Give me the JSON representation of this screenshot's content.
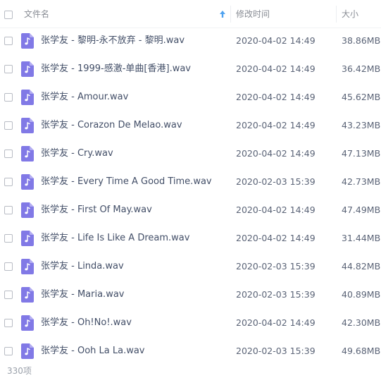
{
  "header": {
    "name_label": "文件名",
    "date_label": "修改时间",
    "size_label": "大小",
    "sort_icon": "sort-ascending-arrow"
  },
  "colors": {
    "icon_purple": "#8179e6",
    "sort_arrow": "#4ea2f0"
  },
  "files": [
    {
      "name": "张学友 -  黎明-永不放弃 - 黎明.wav",
      "date": "2020-04-02 14:49",
      "size": "38.86MB",
      "icon": "audio-file-icon"
    },
    {
      "name": "张学友 - 1999-感激-单曲[香港].wav",
      "date": "2020-04-02 14:49",
      "size": "36.42MB",
      "icon": "audio-file-icon"
    },
    {
      "name": "张学友 - Amour.wav",
      "date": "2020-04-02 14:49",
      "size": "45.62MB",
      "icon": "audio-file-icon"
    },
    {
      "name": "张学友 - Corazon De Melao.wav",
      "date": "2020-04-02 14:49",
      "size": "43.23MB",
      "icon": "audio-file-icon"
    },
    {
      "name": "张学友 - Cry.wav",
      "date": "2020-04-02 14:49",
      "size": "47.13MB",
      "icon": "audio-file-icon"
    },
    {
      "name": "张学友 - Every Time A Good Time.wav",
      "date": "2020-02-03 15:39",
      "size": "42.73MB",
      "icon": "audio-file-icon"
    },
    {
      "name": "张学友 - First Of May.wav",
      "date": "2020-04-02 14:49",
      "size": "47.49MB",
      "icon": "audio-file-icon"
    },
    {
      "name": "张学友 - Life Is Like A Dream.wav",
      "date": "2020-04-02 14:49",
      "size": "31.44MB",
      "icon": "audio-file-icon"
    },
    {
      "name": "张学友 - Linda.wav",
      "date": "2020-02-03 15:39",
      "size": "44.82MB",
      "icon": "audio-file-icon"
    },
    {
      "name": "张学友 - Maria.wav",
      "date": "2020-02-03 15:39",
      "size": "40.89MB",
      "icon": "audio-file-icon"
    },
    {
      "name": "张学友 - Oh!No!.wav",
      "date": "2020-04-02 14:49",
      "size": "42.30MB",
      "icon": "audio-file-icon"
    },
    {
      "name": "张学友 - Ooh La La.wav",
      "date": "2020-02-03 15:39",
      "size": "49.68MB",
      "icon": "audio-file-icon"
    }
  ],
  "footer": {
    "count": "330项"
  }
}
